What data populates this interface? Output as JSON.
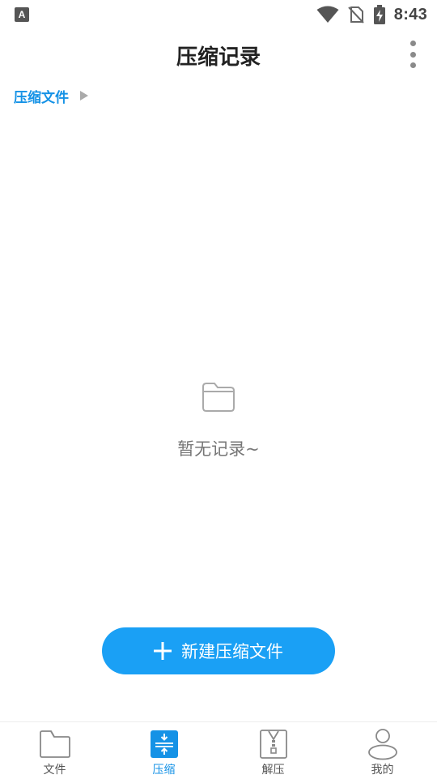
{
  "status_bar": {
    "time": "8:43",
    "icons": [
      "keyboard-a-icon",
      "wifi-icon",
      "no-sim-icon",
      "battery-charging-icon"
    ]
  },
  "header": {
    "title": "压缩记录",
    "menu_icon": "more-vertical-icon"
  },
  "breadcrumb": {
    "label": "压缩文件",
    "arrow_icon": "triangle-right-icon"
  },
  "empty_state": {
    "icon": "folder-icon",
    "text": "暂无记录~"
  },
  "new_button": {
    "icon": "plus-icon",
    "label": "新建压缩文件"
  },
  "tabs": [
    {
      "label": "文件",
      "icon": "folder-icon",
      "active": false
    },
    {
      "label": "压缩",
      "icon": "compress-icon",
      "active": true
    },
    {
      "label": "解压",
      "icon": "zip-file-icon",
      "active": false
    },
    {
      "label": "我的",
      "icon": "user-icon",
      "active": false
    }
  ],
  "colors": {
    "accent": "#1592e6",
    "button": "#1aa0f5",
    "muted_text": "#777777"
  }
}
